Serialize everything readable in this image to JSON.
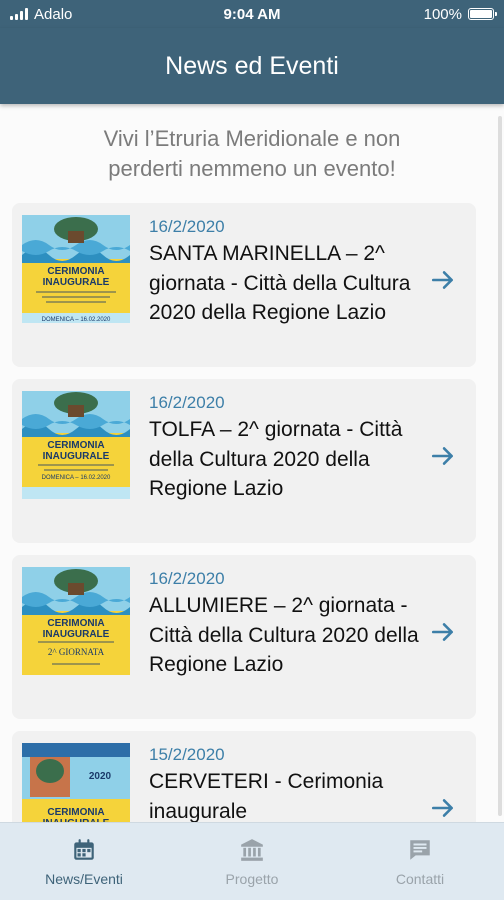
{
  "status": {
    "carrier": "Adalo",
    "time": "9:04 AM",
    "battery": "100%",
    "battery_level": 1.0
  },
  "header": {
    "title": "News ed Eventi"
  },
  "intro": {
    "line1": "Vivi l’Etruria Meridionale e non",
    "line2": "perderti nemmeno un evento!"
  },
  "events": [
    {
      "date": "16/2/2020",
      "title": "SANTA MARINELLA – 2^ giornata - Città della Cultura 2020 della Regione Lazio",
      "poster_heading": "CERIMONIA INAUGURALE",
      "poster_footer": "DOMENICA – 16.02.2020"
    },
    {
      "date": "16/2/2020",
      "title": "TOLFA – 2^ giornata - Città della Cultura 2020 della Regione Lazio",
      "poster_heading": "CERIMONIA INAUGURALE",
      "poster_footer": "DOMENICA – 16.02.2020"
    },
    {
      "date": "16/2/2020",
      "title": "ALLUMIERE – 2^ giornata - Città della Cultura 2020 della Regione Lazio",
      "poster_heading": "CERIMONIA INAUGURALE",
      "poster_footer": "2^ GIORNATA"
    },
    {
      "date": "15/2/2020",
      "title": "CERVETERI - Cerimonia inaugurale",
      "poster_heading": "CERIMONIA INAUGURALE",
      "poster_footer": "2020"
    }
  ],
  "tabs": [
    {
      "label": "News/Eventi",
      "icon": "calendar-icon",
      "active": true
    },
    {
      "label": "Progetto",
      "icon": "bank-icon",
      "active": false
    },
    {
      "label": "Contatti",
      "icon": "chat-icon",
      "active": false
    }
  ],
  "colors": {
    "primary": "#3e6379",
    "accent": "#3d7fa8",
    "card_bg": "#f1f1f1",
    "tab_bg": "#dfe9f1",
    "poster_yellow": "#f5d33a"
  }
}
